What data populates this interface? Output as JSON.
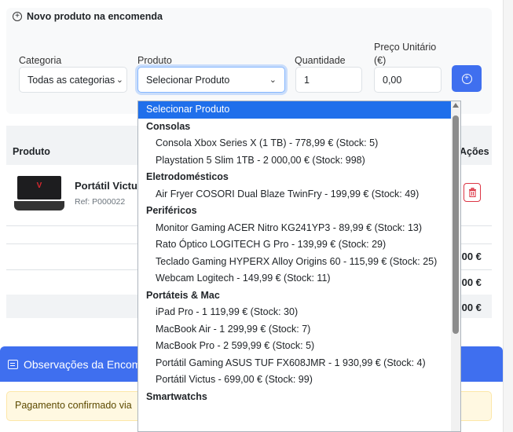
{
  "new_item": {
    "title": "Novo produto na encomenda",
    "labels": {
      "category": "Categoria",
      "product": "Produto",
      "quantity": "Quantidade",
      "unit_price_line1": "Preço Unitário",
      "unit_price_line2": "(€)"
    },
    "category_value": "Todas as categorias",
    "product_value": "Selecionar Produto",
    "quantity_value": "1",
    "unit_price_value": "0,00"
  },
  "table": {
    "col_product": "Produto",
    "col_actions": "Ações",
    "row": {
      "name": "Portátil Victu",
      "ref": "Ref: P000022"
    },
    "totals": [
      ",00 €",
      ",00 €",
      ",00 €"
    ]
  },
  "observations": {
    "title": "Observações da Encom",
    "text": "Pagamento confirmado via"
  },
  "dropdown": {
    "placeholder": "Selecionar Produto",
    "groups": [
      {
        "label": "Consolas",
        "options": [
          "Consola Xbox Series X (1 TB) - 778,99 € (Stock: 5)",
          "Playstation 5 Slim 1TB - 2 000,00 € (Stock: 998)"
        ]
      },
      {
        "label": "Eletrodomésticos",
        "options": [
          "Air Fryer COSORI Dual Blaze TwinFry - 199,99 € (Stock: 49)"
        ]
      },
      {
        "label": "Periféricos",
        "options": [
          "Monitor Gaming ACER Nitro KG241YP3 - 89,99 € (Stock: 13)",
          "Rato Óptico LOGITECH G Pro - 139,99 € (Stock: 29)",
          "Teclado Gaming HYPERX Alloy Origins 60 - 115,99 € (Stock: 25)",
          "Webcam Logitech - 149,99 € (Stock: 11)"
        ]
      },
      {
        "label": "Portáteis & Mac",
        "options": [
          "iPad Pro - 1 119,99 € (Stock: 30)",
          "MacBook Air - 1 299,99 € (Stock: 7)",
          "MacBook Pro - 2 599,99 € (Stock: 5)",
          "Portátil Gaming ASUS TUF FX608JMR - 1 930,99 € (Stock: 4)",
          "Portátil Victus - 699,00 € (Stock: 99)"
        ]
      },
      {
        "label": "Smartwatchs",
        "options": []
      }
    ]
  },
  "colors": {
    "primary": "#3f6fef",
    "selected_option": "#1f6feb",
    "danger": "#dc3545",
    "warning_bg": "#fff8e1"
  }
}
